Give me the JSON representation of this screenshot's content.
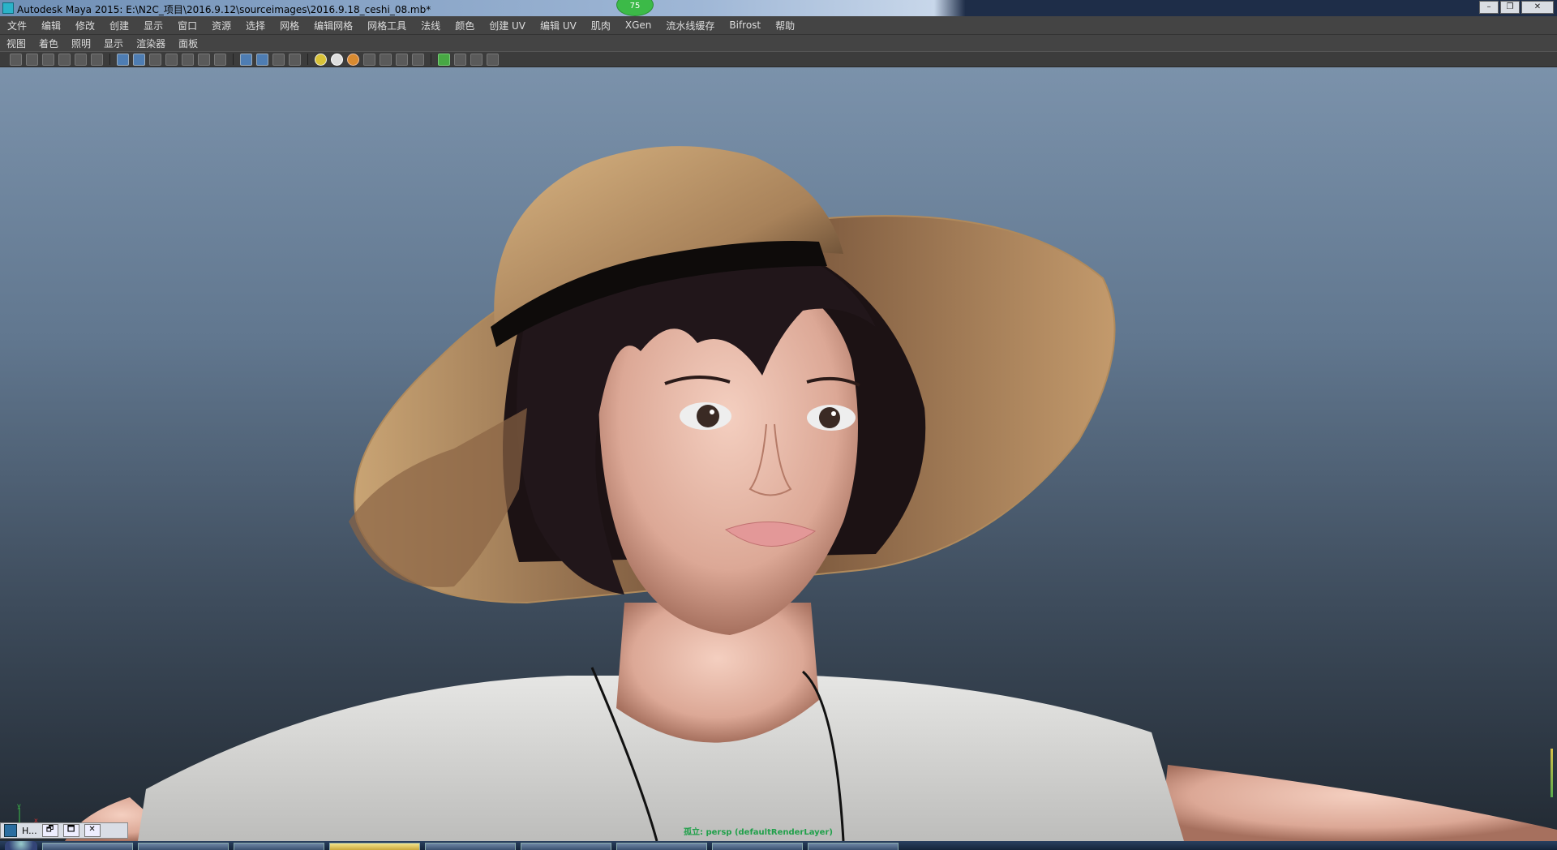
{
  "window": {
    "title": "Autodesk Maya 2015: E:\\N2C_项目\\2016.9.12\\sourceimages\\2016.9.18_ceshi_08.mb*",
    "fps_badge": "75",
    "buttons": [
      "–",
      "❐",
      "✕"
    ]
  },
  "main_menu": {
    "items": [
      "文件",
      "编辑",
      "修改",
      "创建",
      "显示",
      "窗口",
      "资源",
      "选择",
      "网格",
      "编辑网格",
      "网格工具",
      "法线",
      "颜色",
      "创建 UV",
      "编辑 UV",
      "肌肉",
      "XGen",
      "流水线缓存",
      "Bifrost",
      "帮助"
    ]
  },
  "panel_menu": {
    "items": [
      "视图",
      "着色",
      "照明",
      "显示",
      "渲染器",
      "面板"
    ]
  },
  "toolbar": {
    "icons": [
      "camera-select-icon",
      "camera-attributes-icon",
      "bookmark-icon",
      "image-plane-icon",
      "2d-pan-zoom-icon",
      "grease-pencil-icon",
      "grid-icon",
      "film-gate-icon",
      "resolution-gate-icon",
      "gate-mask-icon",
      "field-chart-icon",
      "safe-action-icon",
      "safe-title-icon",
      "wireframe-icon",
      "smooth-shade-icon",
      "shaded-wireframe-icon",
      "textured-icon",
      "use-all-lights-icon",
      "default-light-icon",
      "shadows-icon",
      "screen-space-ao-icon",
      "motion-blur-icon",
      "anti-aliasing-icon",
      "depth-of-field-icon",
      "isolate-select-icon",
      "xray-icon",
      "xray-active-icon",
      "xray-joints-icon"
    ]
  },
  "viewport": {
    "camera_label": "孤立: persp (defaultRenderLayer)",
    "axis_labels": {
      "x": "x",
      "y": "y"
    }
  },
  "minimized_window": {
    "label": "H...",
    "buttons": [
      "🗗",
      "🗖",
      "✕"
    ]
  },
  "colors": {
    "menu_bg": "#444444",
    "viewport_top": "#7b92ab",
    "viewport_bottom": "#222a33",
    "hat": "#c8a070",
    "hair": "#1c1214",
    "skin": "#e8b8a4",
    "shirt": "#d8d8d6",
    "camera_label": "#20a04a"
  }
}
